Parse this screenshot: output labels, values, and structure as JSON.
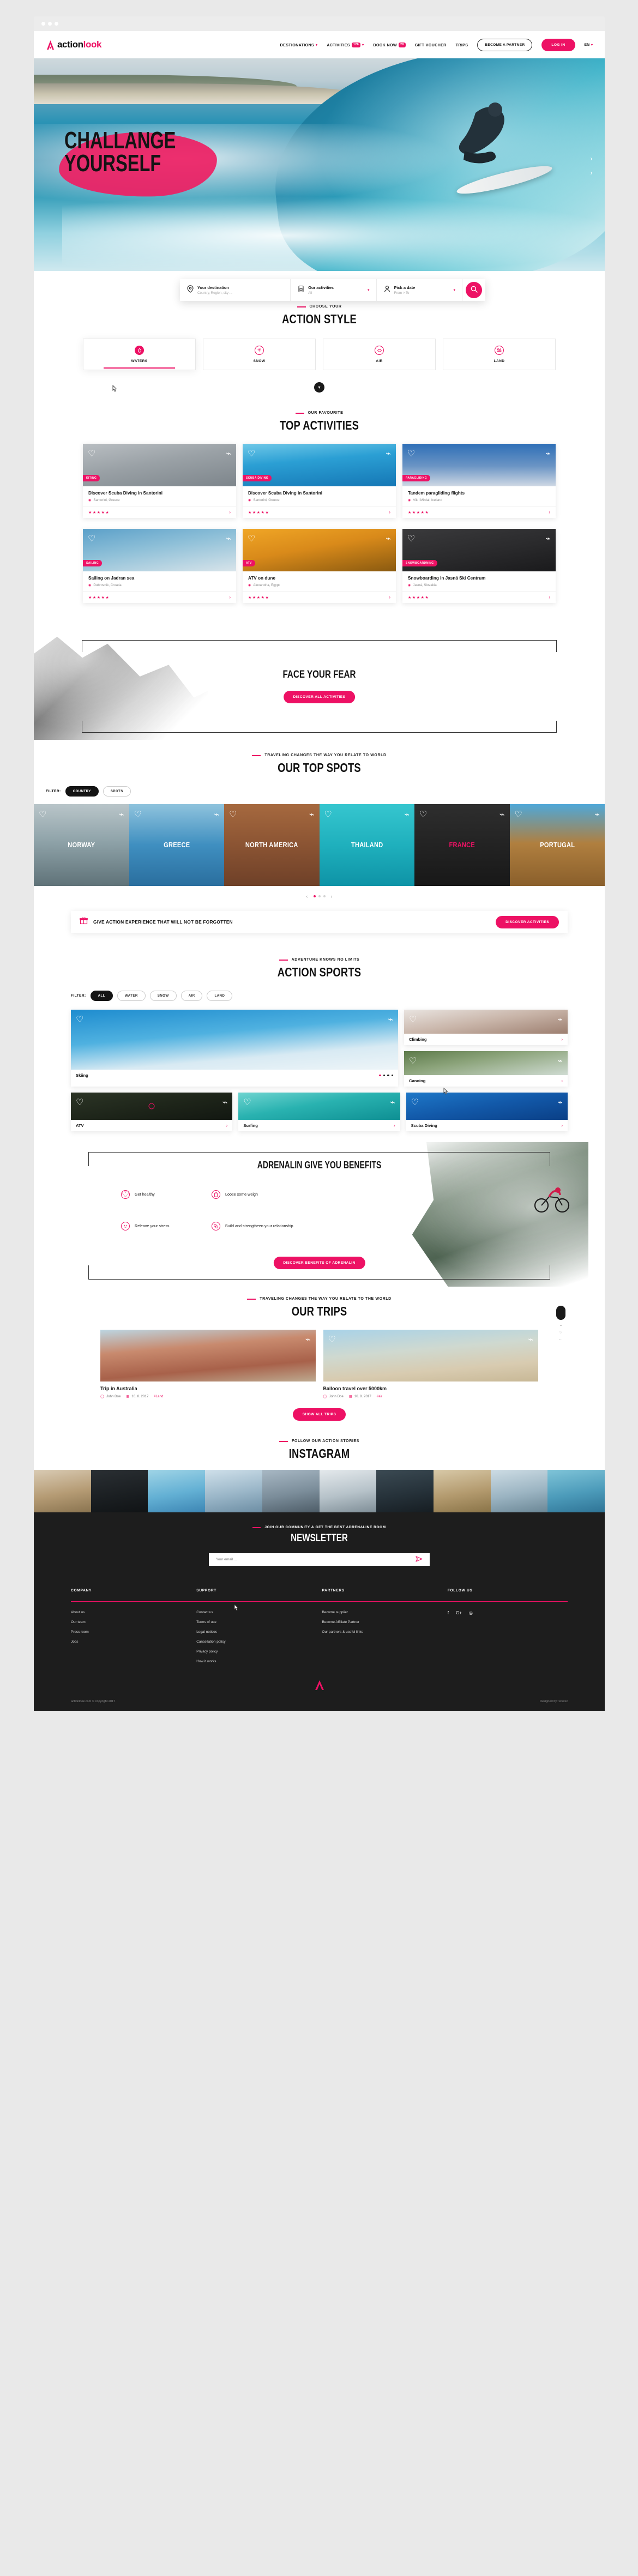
{
  "header": {
    "logo_a": "action",
    "logo_b": "look",
    "nav": [
      {
        "label": "DESTIONATIONS",
        "badge": null,
        "chevron": true
      },
      {
        "label": "ACTIVITIES",
        "badge": "126",
        "chevron": true
      },
      {
        "label": "BOOK NOW",
        "badge": "28",
        "chevron": false
      },
      {
        "label": "GIFT VOUCHER",
        "badge": null,
        "chevron": false
      },
      {
        "label": "TRIPS",
        "badge": null,
        "chevron": false
      }
    ],
    "partner_button": "BECOME A PARTNER",
    "login_button": "LOG IN",
    "language": "EN"
  },
  "hero": {
    "line1": "CHALLANGE",
    "line2": "YOURSELF"
  },
  "search": {
    "destination": {
      "label": "Your destination",
      "placeholder": "Country, Region, city ...",
      "icon": "pin-icon"
    },
    "activities": {
      "label": "Our activities",
      "value": "All",
      "icon": "ticket-icon"
    },
    "date": {
      "label": "Pick a date",
      "value": "From > To",
      "icon": "person-icon"
    },
    "submit_icon": "search-icon"
  },
  "action_style": {
    "eyebrow": "CHOOSE YOUR",
    "title": "ACTION STYLE",
    "items": [
      {
        "label": "WATERS",
        "icon": "water-drop-icon",
        "active": true
      },
      {
        "label": "SNOW",
        "icon": "snowflake-icon",
        "active": false
      },
      {
        "label": "AIR",
        "icon": "paraglider-icon",
        "active": false
      },
      {
        "label": "LAND",
        "icon": "map-pin-tree-icon",
        "active": false
      }
    ]
  },
  "top_activities": {
    "eyebrow": "OUR FAVOURITE",
    "title": "TOP ACTIVITIES",
    "cards": [
      {
        "tag": "KITING",
        "title": "Discover Scuba Diving in Santorini",
        "location": "Santorini, Greece",
        "stars": "★★★★★"
      },
      {
        "tag": "SCUBA DIVING",
        "title": "Discover Scuba Diving in Santorini",
        "location": "Santorini, Greece",
        "stars": "★★★★★"
      },
      {
        "tag": "PARAGLIDING",
        "title": "Tandem paragliding flights",
        "location": "Vik i Mirdal, Iceland",
        "stars": "★★★★★"
      },
      {
        "tag": "SAILING",
        "title": "Sailing on Jadran sea",
        "location": "Dubrovnik, Croatia",
        "stars": "★★★★★"
      },
      {
        "tag": "ATV",
        "title": "ATV on dune",
        "location": "Alexandria, Egypt",
        "stars": "★★★★★"
      },
      {
        "tag": "SNOWBOARDNING",
        "title": "Snowboarding in Jasná Ski Centrum",
        "location": "Jasná, Slovakia",
        "stars": "★★★★★"
      }
    ]
  },
  "face_your_fear": {
    "title": "FACE YOUR FEAR",
    "button": "DISCOVER ALL ACTIVITIES"
  },
  "top_spots": {
    "eyebrow": "TRAVELING CHANGES THE WAY YOU RELATE TO WORLD",
    "title": "OUR TOP SPOTS",
    "filter_label": "FILTER:",
    "filters": [
      {
        "label": "COUNTRY",
        "active": true
      },
      {
        "label": "SPOTS",
        "active": false
      }
    ],
    "spots": [
      {
        "name": "NORWAY",
        "active": false
      },
      {
        "name": "GREECE",
        "active": false
      },
      {
        "name": "NORTH AMERICA",
        "active": false
      },
      {
        "name": "THAILAND",
        "active": false
      },
      {
        "name": "FRANCE",
        "active": true
      },
      {
        "name": "PORTUGAL",
        "active": false
      }
    ]
  },
  "voucher": {
    "icon": "gift-icon",
    "text": "GIVE ACTION EXPERIENCE THAT WILL NOT BE FORGOTTEN",
    "button": "DISCOVER ACTIVITIES"
  },
  "action_sports": {
    "eyebrow": "ADVENTURE KNOWS NO LIMITS",
    "title": "ACTION SPORTS",
    "filter_label": "FILTER:",
    "filters": [
      {
        "label": "ALL",
        "active": true
      },
      {
        "label": "WATER",
        "active": false
      },
      {
        "label": "SNOW",
        "active": false
      },
      {
        "label": "AIR",
        "active": false
      },
      {
        "label": "LAND",
        "active": false
      }
    ],
    "tiles": [
      {
        "name": "Skiing",
        "kind": "main"
      },
      {
        "name": "Climbing",
        "kind": "side"
      },
      {
        "name": "Canoing",
        "kind": "side"
      },
      {
        "name": "ATV",
        "kind": "row2"
      },
      {
        "name": "Surfing",
        "kind": "row2"
      },
      {
        "name": "Scuba Diving",
        "kind": "row2"
      }
    ]
  },
  "benefits": {
    "title": "ADRENALIN GIVE YOU BENEFITS",
    "items": [
      {
        "label": "Get healthy",
        "icon": "heart-icon"
      },
      {
        "label": "Loose some weigh",
        "icon": "bottle-icon"
      },
      {
        "label": "Releave your stress",
        "icon": "smiley-icon"
      },
      {
        "label": "Build and strengtheen your relationship",
        "icon": "link-icon"
      }
    ],
    "button": "DISCOVER BENEFITS OF ADRENALIN"
  },
  "trips": {
    "eyebrow": "TRAVELING CHANGES THE WAY YOU RELATE TO THE WORLD",
    "title": "OUR TRIPS",
    "items": [
      {
        "title": "Trip in Australia",
        "author": "John Doe",
        "date": "16. 8. 2017",
        "tag": "#Land"
      },
      {
        "title": "Balloon travel over 5000km",
        "author": "John Doe",
        "date": "16. 8. 2017",
        "tag": "#air"
      }
    ],
    "button": "SHOW ALL TRIPS"
  },
  "instagram": {
    "eyebrow": "FOLLOW OUR ACTION STORIES",
    "title": "INSTAGRAM"
  },
  "newsletter": {
    "eyebrow": "JOIN OUR COMMUNITY & GET THE BEST ADRENALINE ROOM",
    "title": "NEWSLETTER",
    "placeholder": "Your email ...",
    "send_icon": "send-icon"
  },
  "footer": {
    "columns": [
      {
        "head": "COMPANY",
        "links": [
          "About us",
          "Our team",
          "Press room",
          "Jobs"
        ]
      },
      {
        "head": "SUPPORT",
        "links": [
          "Contact us",
          "Terms of use",
          "Legal notices",
          "Cancellation policy",
          "Privacy policy",
          "How it works"
        ]
      },
      {
        "head": "PARTNERS",
        "links": [
          "Become supplier",
          "Become Affiliate Partner",
          "Our partners & useful links"
        ]
      },
      {
        "head": "FOLLOW US",
        "links": []
      }
    ],
    "social": [
      "facebook-icon",
      "google-plus-icon",
      "instagram-icon"
    ],
    "copyright": "actionlook.com © copyright 2017",
    "credit": "Designed by: xxxxxx"
  },
  "colors": {
    "accent": "#ed1164",
    "dark": "#1d1d1d",
    "text": "#141414"
  }
}
